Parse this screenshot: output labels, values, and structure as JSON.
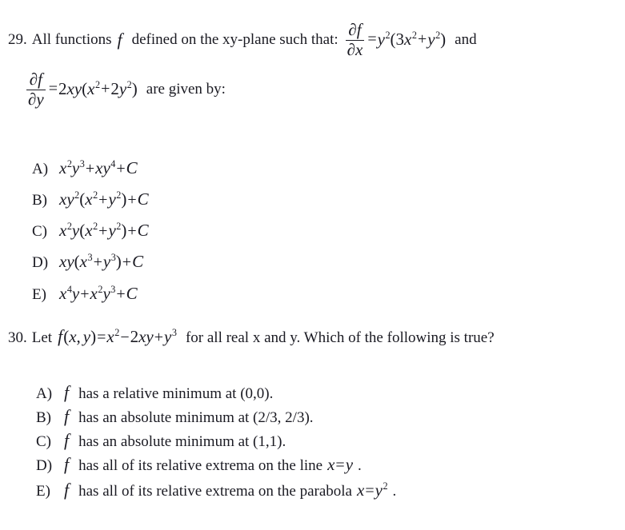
{
  "document": {
    "background_color": "#ffffff",
    "text_color": "#1a1a22"
  },
  "questions": [
    {
      "number": "29.",
      "stem_part1": "All functions",
      "stem_fn": "f",
      "stem_part2": "defined on the xy-plane such that:",
      "eq1": {
        "fraction_numerator": "∂f",
        "fraction_denominator": "∂x",
        "equals": "=",
        "rhs_base": "y",
        "rhs_exp": "2",
        "open_paren": "(",
        "term1_coeff": "3",
        "term1_base": "x",
        "term1_exp": "2",
        "plus": "+",
        "term2_base": "y",
        "term2_exp": "2",
        "close_paren": ")"
      },
      "conjunction": "and",
      "eq2": {
        "fraction_numerator": "∂f",
        "fraction_denominator": "∂y",
        "equals": "=",
        "coeff": "2",
        "var_x": "x",
        "var_y": "y",
        "open_paren": "(",
        "term1_base": "x",
        "term1_exp": "2",
        "plus": "+",
        "term2_coeff": "2",
        "term2_base": "y",
        "term2_exp": "2",
        "close_paren": ")"
      },
      "stem_tail": "are given by:",
      "options": [
        {
          "label": "A)",
          "expression_plain": "x²y³ + xy⁴ + C"
        },
        {
          "label": "B)",
          "expression_plain": "xy²(x² + y²) + C"
        },
        {
          "label": "C)",
          "expression_plain": "x²y(x² + y²) + C"
        },
        {
          "label": "D)",
          "expression_plain": "xy(x³ + y³) + C"
        },
        {
          "label": "E)",
          "expression_plain": "x⁴y + x²y³ + C"
        }
      ]
    },
    {
      "number": "30.",
      "stem_part1": "Let",
      "function_def": {
        "fn": "f",
        "open": "(",
        "arg1": "x",
        "comma": ",",
        "arg2": "y",
        "close": ")",
        "equals": "=",
        "t1_base": "x",
        "t1_exp": "2",
        "minus": "−",
        "t2_coeff": "2",
        "t2_x": "x",
        "t2_y": "y",
        "plus": "+",
        "t3_base": "y",
        "t3_exp": "3"
      },
      "stem_part2": "for all real x and y. Which of the following is true?",
      "options": [
        {
          "label": "A)",
          "fn": "f",
          "text": "has a relative minimum at (0,0)."
        },
        {
          "label": "B)",
          "fn": "f",
          "text": "has an absolute minimum at (2/3, 2/3)."
        },
        {
          "label": "C)",
          "fn": "f",
          "text": "has an absolute minimum at (1,1)."
        },
        {
          "label": "D)",
          "fn": "f",
          "text": "has all of its relative extrema on the line",
          "tail_eq_lhs": "x",
          "tail_eq_op": "=",
          "tail_eq_rhs": "y",
          "tail_period": "."
        },
        {
          "label": "E)",
          "fn": "f",
          "text": "has all of its relative extrema on the parabola",
          "tail_eq_lhs": "x",
          "tail_eq_op": "=",
          "tail_eq_rhs": "y",
          "tail_eq_rhs_exp": "2",
          "tail_period": "."
        }
      ]
    }
  ]
}
